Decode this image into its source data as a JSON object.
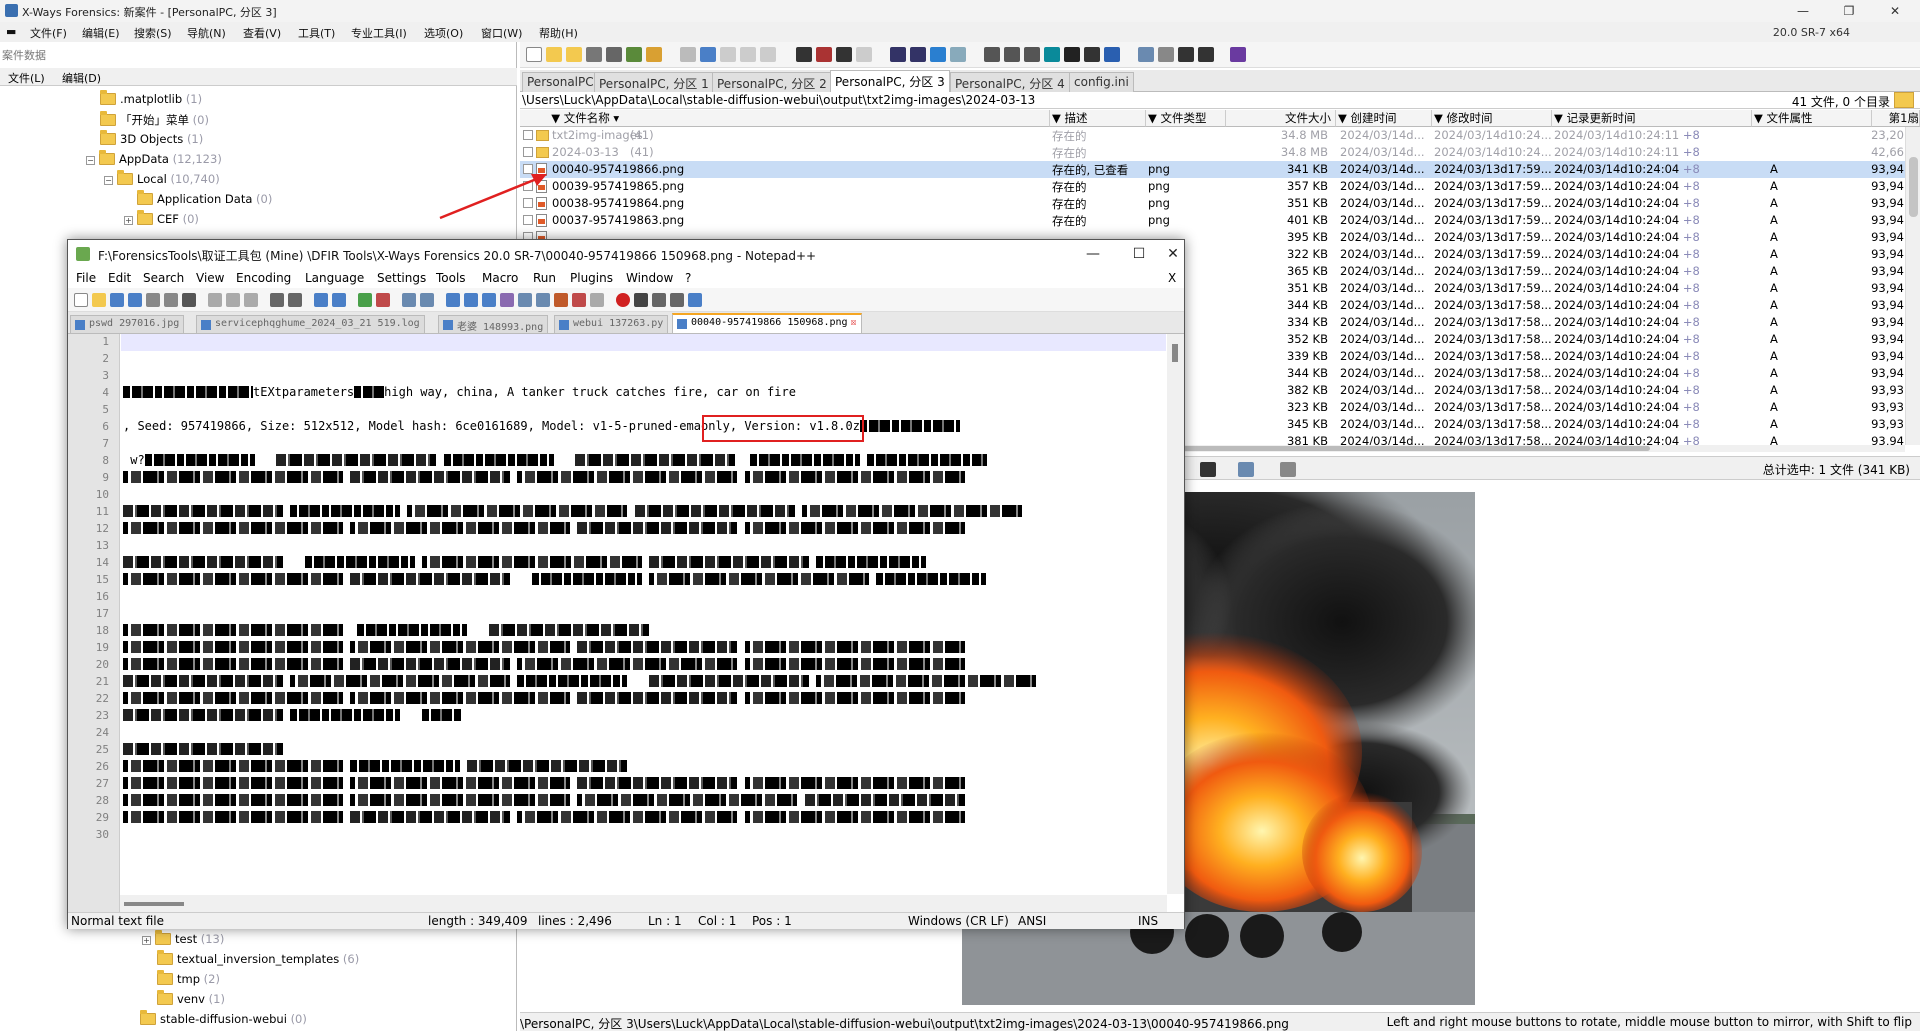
{
  "main_window": {
    "title": "X-Ways Forensics: 新案件 - [PersonalPC, 分区 3]",
    "version": "20.0 SR-7 x64",
    "menu": [
      "文件(F)",
      "编辑(E)",
      "搜索(S)",
      "导航(N)",
      "查看(V)",
      "工具(T)",
      "专业工具(I)",
      "选项(O)",
      "窗口(W)",
      "帮助(H)"
    ]
  },
  "case_panel": {
    "header": "案件数据",
    "submenu": [
      "文件(L)",
      "编辑(D)"
    ],
    "tree": [
      {
        "label": ".matplotlib",
        "count": "(1)"
      },
      {
        "label": "「开始」菜单",
        "count": "(0)"
      },
      {
        "label": "3D Objects",
        "count": "(1)"
      },
      {
        "label": "AppData",
        "count": "(12,123)"
      },
      {
        "label": "Local",
        "count": "(10,740)"
      },
      {
        "label": "Application Data",
        "count": "(0)"
      },
      {
        "label": "CEF",
        "count": "(0)"
      }
    ],
    "tree_bottom": [
      {
        "label": "test",
        "count": "(13)"
      },
      {
        "label": "textual_inversion_templates",
        "count": "(6)"
      },
      {
        "label": "tmp",
        "count": "(2)"
      },
      {
        "label": "venv",
        "count": "(1)"
      },
      {
        "label": "stable-diffusion-webui",
        "count": "(0)"
      }
    ]
  },
  "tabs": [
    {
      "label": "PersonalPC",
      "active": false
    },
    {
      "label": "PersonalPC, 分区 1",
      "active": false
    },
    {
      "label": "PersonalPC, 分区 2",
      "active": false
    },
    {
      "label": "PersonalPC, 分区 3",
      "active": true
    },
    {
      "label": "PersonalPC, 分区 4",
      "active": false
    },
    {
      "label": "config.ini",
      "active": false
    }
  ],
  "path_bar": {
    "path": "\\Users\\Luck\\AppData\\Local\\stable-diffusion-webui\\output\\txt2img-images\\2024-03-13",
    "count": "41 文件, 0 个目录"
  },
  "file_list": {
    "columns": [
      "文件名称",
      "描述",
      "文件类型",
      "文件大小",
      "创建时间",
      "修改时间",
      "记录更新时间",
      "文件属性",
      "第1扇"
    ],
    "rows": [
      {
        "name": "txt2img-images",
        "count": "(41)",
        "desc": "存在的",
        "type": "",
        "size": "34.8 MB",
        "created": "2024/03/14d...",
        "modified": "2024/03/14d10:24...",
        "record": "2024/03/14d10:24:11",
        "plus": "+8",
        "attr": "",
        "first": "23,20",
        "grey": true,
        "folder": true,
        "selected": false
      },
      {
        "name": "2024-03-13",
        "count": "(41)",
        "desc": "存在的",
        "type": "",
        "size": "34.8 MB",
        "created": "2024/03/14d...",
        "modified": "2024/03/14d10:24...",
        "record": "2024/03/14d10:24:11",
        "plus": "+8",
        "attr": "",
        "first": "42,66",
        "grey": true,
        "folder": true,
        "selected": false
      },
      {
        "name": "00040-957419866.png",
        "count": "",
        "desc": "存在的, 已查看",
        "type": "png",
        "size": "341 KB",
        "created": "2024/03/14d...",
        "modified": "2024/03/13d17:59...",
        "record": "2024/03/14d10:24:04",
        "plus": "+8",
        "attr": "A",
        "first": "93,94",
        "grey": false,
        "folder": false,
        "selected": true
      },
      {
        "name": "00039-957419865.png",
        "count": "",
        "desc": "存在的",
        "type": "png",
        "size": "357 KB",
        "created": "2024/03/14d...",
        "modified": "2024/03/13d17:59...",
        "record": "2024/03/14d10:24:04",
        "plus": "+8",
        "attr": "A",
        "first": "93,94",
        "grey": false,
        "folder": false,
        "selected": false
      },
      {
        "name": "00038-957419864.png",
        "count": "",
        "desc": "存在的",
        "type": "png",
        "size": "351 KB",
        "created": "2024/03/14d...",
        "modified": "2024/03/13d17:59...",
        "record": "2024/03/14d10:24:04",
        "plus": "+8",
        "attr": "A",
        "first": "93,94",
        "grey": false,
        "folder": false,
        "selected": false
      },
      {
        "name": "00037-957419863.png",
        "count": "",
        "desc": "存在的",
        "type": "png",
        "size": "401 KB",
        "created": "2024/03/14d...",
        "modified": "2024/03/13d17:59...",
        "record": "2024/03/14d10:24:04",
        "plus": "+8",
        "attr": "A",
        "first": "93,94",
        "grey": false,
        "folder": false,
        "selected": false
      },
      {
        "name": "",
        "count": "",
        "desc": "",
        "type": "",
        "size": "395 KB",
        "created": "2024/03/14d...",
        "modified": "2024/03/13d17:59...",
        "record": "2024/03/14d10:24:04",
        "plus": "+8",
        "attr": "A",
        "first": "93,94",
        "grey": false,
        "folder": false,
        "selected": false
      },
      {
        "name": "",
        "count": "",
        "desc": "",
        "type": "",
        "size": "322 KB",
        "created": "2024/03/14d...",
        "modified": "2024/03/13d17:59...",
        "record": "2024/03/14d10:24:04",
        "plus": "+8",
        "attr": "A",
        "first": "93,94",
        "grey": false,
        "folder": false,
        "selected": false
      },
      {
        "name": "",
        "count": "",
        "desc": "",
        "type": "",
        "size": "365 KB",
        "created": "2024/03/14d...",
        "modified": "2024/03/13d17:59...",
        "record": "2024/03/14d10:24:04",
        "plus": "+8",
        "attr": "A",
        "first": "93,94",
        "grey": false,
        "folder": false,
        "selected": false
      },
      {
        "name": "",
        "count": "",
        "desc": "",
        "type": "",
        "size": "351 KB",
        "created": "2024/03/14d...",
        "modified": "2024/03/13d17:59...",
        "record": "2024/03/14d10:24:04",
        "plus": "+8",
        "attr": "A",
        "first": "93,94",
        "grey": false,
        "folder": false,
        "selected": false
      },
      {
        "name": "",
        "count": "",
        "desc": "",
        "type": "",
        "size": "344 KB",
        "created": "2024/03/14d...",
        "modified": "2024/03/13d17:58...",
        "record": "2024/03/14d10:24:04",
        "plus": "+8",
        "attr": "A",
        "first": "93,94",
        "grey": false,
        "folder": false,
        "selected": false
      },
      {
        "name": "",
        "count": "",
        "desc": "",
        "type": "",
        "size": "334 KB",
        "created": "2024/03/14d...",
        "modified": "2024/03/13d17:58...",
        "record": "2024/03/14d10:24:04",
        "plus": "+8",
        "attr": "A",
        "first": "93,94",
        "grey": false,
        "folder": false,
        "selected": false
      },
      {
        "name": "",
        "count": "",
        "desc": "",
        "type": "",
        "size": "352 KB",
        "created": "2024/03/14d...",
        "modified": "2024/03/13d17:58...",
        "record": "2024/03/14d10:24:04",
        "plus": "+8",
        "attr": "A",
        "first": "93,94",
        "grey": false,
        "folder": false,
        "selected": false
      },
      {
        "name": "",
        "count": "",
        "desc": "",
        "type": "",
        "size": "339 KB",
        "created": "2024/03/14d...",
        "modified": "2024/03/13d17:58...",
        "record": "2024/03/14d10:24:04",
        "plus": "+8",
        "attr": "A",
        "first": "93,94",
        "grey": false,
        "folder": false,
        "selected": false
      },
      {
        "name": "",
        "count": "",
        "desc": "",
        "type": "",
        "size": "344 KB",
        "created": "2024/03/14d...",
        "modified": "2024/03/13d17:58...",
        "record": "2024/03/14d10:24:04",
        "plus": "+8",
        "attr": "A",
        "first": "93,94",
        "grey": false,
        "folder": false,
        "selected": false
      },
      {
        "name": "",
        "count": "",
        "desc": "",
        "type": "",
        "size": "382 KB",
        "created": "2024/03/14d...",
        "modified": "2024/03/13d17:58...",
        "record": "2024/03/14d10:24:04",
        "plus": "+8",
        "attr": "A",
        "first": "93,93",
        "grey": false,
        "folder": false,
        "selected": false
      },
      {
        "name": "",
        "count": "",
        "desc": "",
        "type": "",
        "size": "323 KB",
        "created": "2024/03/14d...",
        "modified": "2024/03/13d17:58...",
        "record": "2024/03/14d10:24:04",
        "plus": "+8",
        "attr": "A",
        "first": "93,93",
        "grey": false,
        "folder": false,
        "selected": false
      },
      {
        "name": "",
        "count": "",
        "desc": "",
        "type": "",
        "size": "345 KB",
        "created": "2024/03/14d...",
        "modified": "2024/03/13d17:58...",
        "record": "2024/03/14d10:24:04",
        "plus": "+8",
        "attr": "A",
        "first": "93,93",
        "grey": false,
        "folder": false,
        "selected": false
      },
      {
        "name": "",
        "count": "",
        "desc": "",
        "type": "",
        "size": "381 KB",
        "created": "2024/03/14d...",
        "modified": "2024/03/13d17:58...",
        "record": "2024/03/14d10:24:04",
        "plus": "+8",
        "attr": "A",
        "first": "93,94",
        "grey": false,
        "folder": false,
        "selected": false
      }
    ]
  },
  "preview": {
    "selection_total": "总计选中: 1 文件 (341 KB)"
  },
  "status_bar": {
    "path": "\\PersonalPC, 分区 3\\Users\\Luck\\AppData\\Local\\stable-diffusion-webui\\output\\txt2img-images\\2024-03-13\\00040-957419866.png",
    "hint": "Left and right mouse buttons to rotate, middle mouse button to mirror, with Shift to flip"
  },
  "notepad": {
    "title": "F:\\ForensicsTools\\取证工具包 (Mine)  \\DFIR Tools\\X-Ways Forensics 20.0 SR-7\\00040-957419866 150968.png - Notepad++",
    "menu": [
      "File",
      "Edit",
      "Search",
      "View",
      "Encoding",
      "Language",
      "Settings",
      "Tools",
      "Macro",
      "Run",
      "Plugins",
      "Window",
      "?"
    ],
    "close_x": "X",
    "tabs": [
      {
        "label": "pswd 297016.jpg",
        "active": false
      },
      {
        "label": "servicephqghume_2024_03_21 519.log",
        "active": false
      },
      {
        "label": "老婆 148993.png",
        "active": false
      },
      {
        "label": "webui 137263.py",
        "active": false
      },
      {
        "label": "00040-957419866 150968.png",
        "active": true
      }
    ],
    "line_numbers": [
      "1",
      "2",
      "3",
      "4",
      "5",
      "6",
      "7",
      "8",
      "9",
      "10",
      "11",
      "12",
      "13",
      "14",
      "15",
      "16",
      "17",
      "18",
      "19",
      "20",
      "21",
      "22",
      "23",
      "24",
      "25",
      "26",
      "27",
      "28",
      "29",
      "30"
    ],
    "line4_text": "tEXtparameters",
    "line4_rest": "high way, china, A tanker truck catches fire, car on fire",
    "line6_prefix": ", Seed: 957419866, Size: 512x512, Model hash: 6ce0161689, Model: ",
    "line6_model": "v1-5-pruned-emaonly,",
    "line6_suffix": " Version: v1.8.0z",
    "status": {
      "type": "Normal text file",
      "length": "length : 349,409",
      "lines": "lines : 2,496",
      "ln": "Ln : 1",
      "col": "Col : 1",
      "pos": "Pos : 1",
      "eol": "Windows (CR LF)",
      "enc": "ANSI",
      "ins": "INS"
    }
  }
}
